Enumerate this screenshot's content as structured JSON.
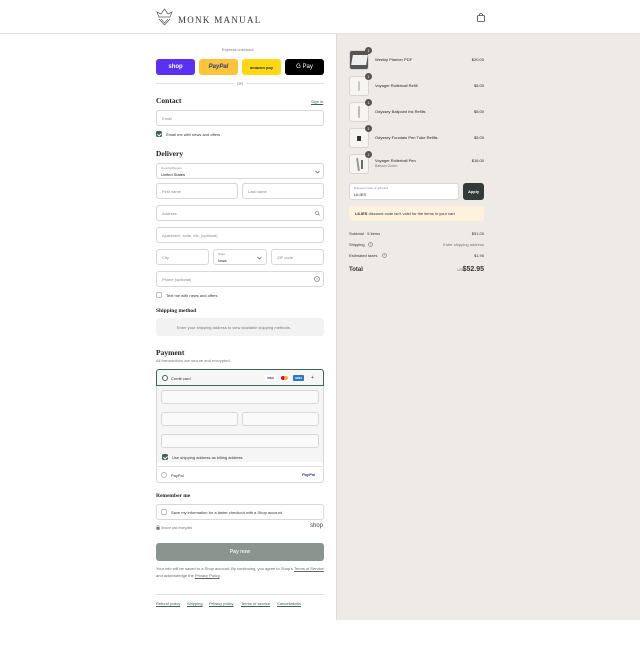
{
  "brand": {
    "name": "MONK MANUAL"
  },
  "express": {
    "title": "Express checkout",
    "buttons": [
      {
        "label": "shop",
        "color": "#5a31f4",
        "text_color": "#ffffff"
      },
      {
        "label": "PayPal",
        "color": "#ffc439",
        "text_color": "#253b80"
      },
      {
        "label": "amazon pay",
        "color": "#ffd814",
        "text_color": "#232f3e"
      },
      {
        "label": "G Pay",
        "color": "#000000",
        "text_color": "#ffffff"
      }
    ],
    "or_label": "OR"
  },
  "contact": {
    "title": "Contact",
    "sign_in": "Sign in",
    "email_placeholder": "Email",
    "email_news": "Email me with news and offers"
  },
  "delivery": {
    "title": "Delivery",
    "country_caption": "Country/Region",
    "country_value": "United States",
    "first_name": "First name",
    "last_name": "Last name",
    "address": "Address",
    "apartment": "Apartment, suite, etc. (optional)",
    "city": "City",
    "state_caption": "State",
    "state_value": "Iowa",
    "zip": "ZIP code",
    "phone": "Phone (optional)",
    "text_news": "Text me with news and offers"
  },
  "shipping_method": {
    "title": "Shipping method",
    "placeholder": "Enter your shipping address to view available shipping methods."
  },
  "payment": {
    "title": "Payment",
    "subtitle": "All transactions are secure and encrypted.",
    "credit_card": "Credit card",
    "card_brands": [
      "VISA",
      "MC",
      "AMEX",
      "+"
    ],
    "billing_same": "Use shipping address as billing address",
    "paypal": "PayPal",
    "paypal_logo": "PayPal"
  },
  "remember": {
    "title": "Remember me",
    "save_info": "Save my information for a faster checkout with a Shop account",
    "secure": "Secure and encrypted",
    "shop_logo": "shop"
  },
  "pay_now": "Pay now",
  "legal": {
    "text_a": "Your info will be saved to a Shop account. By continuing, you agree to Shop's",
    "terms": "Terms of Service",
    "text_b": "and acknowledge the",
    "privacy": "Privacy Policy",
    "end": "."
  },
  "footer_links": [
    "Refund policy",
    "Shipping",
    "Privacy policy",
    "Terms of service",
    "Cancellations"
  ],
  "order": {
    "items": [
      {
        "qty": "1",
        "name": "Weekly Planner PDF",
        "sub": "",
        "price": "$20.00"
      },
      {
        "qty": "1",
        "name": "Voyager Rollerball Refill",
        "sub": "",
        "price": "$5.00"
      },
      {
        "qty": "1",
        "name": "Odyssey Ballpoint Ink Refills",
        "sub": "",
        "price": "$5.00"
      },
      {
        "qty": "1",
        "name": "Odyssey Fountain Pen Tube Refills",
        "sub": "",
        "price": "$5.00"
      },
      {
        "qty": "1",
        "name": "Voyager Rollerball Pen",
        "sub": "Balsam Green",
        "price": "$16.00"
      }
    ],
    "discount_caption": "Discount code or gift card",
    "discount_value": "LILIES",
    "apply": "Apply",
    "discount_error_code": "LILIES",
    "discount_error": "discount code isn't valid for the items in your cart",
    "subtotal_label": "Subtotal · 5 items",
    "subtotal": "$51.00",
    "shipping_label": "Shipping",
    "shipping_value": "Enter shipping address",
    "taxes_label": "Estimated taxes",
    "taxes": "$1.95",
    "total_label": "Total",
    "currency": "USD",
    "total": "$52.95"
  }
}
